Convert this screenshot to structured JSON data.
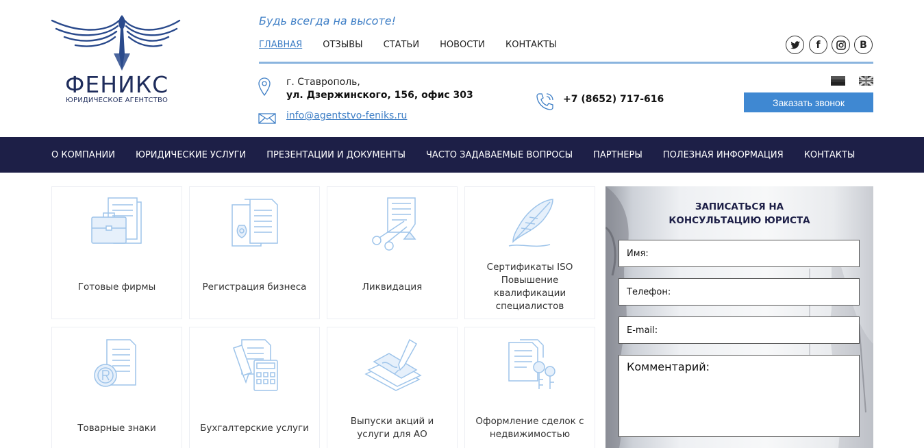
{
  "brand": {
    "name": "ФЕНИКС",
    "subtitle": "ЮРИДИЧЕСКОЕ АГЕНТСТВО"
  },
  "header": {
    "tagline": "Будь всегда на высоте!",
    "top_nav": [
      "ГЛАВНАЯ",
      "ОТЗЫВЫ",
      "СТАТЬИ",
      "НОВОСТИ",
      "КОНТАКТЫ"
    ],
    "active_top_nav": "ГЛАВНАЯ",
    "social": [
      {
        "name": "twitter-icon",
        "glyph": "🐦"
      },
      {
        "name": "facebook-icon",
        "glyph": "f"
      },
      {
        "name": "instagram-icon",
        "glyph": "◎"
      },
      {
        "name": "vk-icon",
        "glyph": "В"
      }
    ],
    "address_line1": "г. Ставрополь,",
    "address_line2": "ул. Дзержинского, 156, офис 303",
    "email": "info@agentstvo-feniks.ru",
    "phone": "+7 (8652) 717-616",
    "callback_label": "Заказать звонок",
    "languages": [
      "ru-flag-icon",
      "uk-flag-icon"
    ]
  },
  "main_nav": [
    "О КОМПАНИИ",
    "ЮРИДИЧЕСКИЕ УСЛУГИ",
    "ПРЕЗЕНТАЦИИ И ДОКУМЕНТЫ",
    "ЧАСТО ЗАДАВАЕМЫЕ ВОПРОСЫ",
    "ПАРТНЕРЫ",
    "ПОЛЕЗНАЯ ИНФОРМАЦИЯ",
    "КОНТАКТЫ"
  ],
  "services": [
    {
      "label": "Готовые фирмы",
      "icon": "briefcase-icon"
    },
    {
      "label": "Регистрация бизнеса",
      "icon": "emblem-document-icon"
    },
    {
      "label": "Ликвидация",
      "icon": "scissors-document-icon"
    },
    {
      "label": "Сертификаты ISO\nПовышение квалификации специалистов",
      "icon": "quill-icon"
    },
    {
      "label": "Товарные знаки",
      "icon": "trademark-icon"
    },
    {
      "label": "Бухгалтерские услуги",
      "icon": "calculator-icon"
    },
    {
      "label": "Выпуски акций и услуги для АО",
      "icon": "signing-pen-icon"
    },
    {
      "label": "Оформление сделок с недвижимостью",
      "icon": "keys-document-icon"
    }
  ],
  "consult_form": {
    "title_line1": "ЗАПИСАТЬСЯ НА",
    "title_line2": "КОНСУЛЬТАЦИЮ ЮРИСТА",
    "name_label": "Имя:",
    "phone_label": "Телефон:",
    "email_label": "E-mail:",
    "comment_label": "Комментарий:"
  },
  "colors": {
    "accent": "#3f88d2",
    "nav_bg": "#1d1f47",
    "brand": "#1f2d5c",
    "icon": "#9ec4ea"
  }
}
